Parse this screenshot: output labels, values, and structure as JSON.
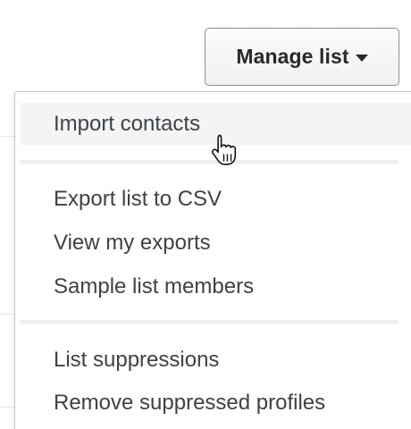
{
  "header": {
    "manage_list_label": "Manage list",
    "caret_icon": "caret-down-icon"
  },
  "menu": {
    "groups": [
      {
        "items": [
          {
            "label": "Import contacts",
            "state": "hover"
          }
        ]
      },
      {
        "items": [
          {
            "label": "Export list to CSV"
          },
          {
            "label": "View my exports"
          },
          {
            "label": "Sample list members"
          }
        ]
      },
      {
        "items": [
          {
            "label": "List suppressions"
          },
          {
            "label": "Remove suppressed profiles"
          }
        ]
      }
    ]
  },
  "cursor": {
    "icon": "pointer-hand-icon"
  },
  "colors": {
    "text": "#3d4246",
    "button_text": "#262a2d",
    "hover_bg": "#f2f4f6",
    "divider": "#eceef0",
    "border": "#8a8f93"
  }
}
